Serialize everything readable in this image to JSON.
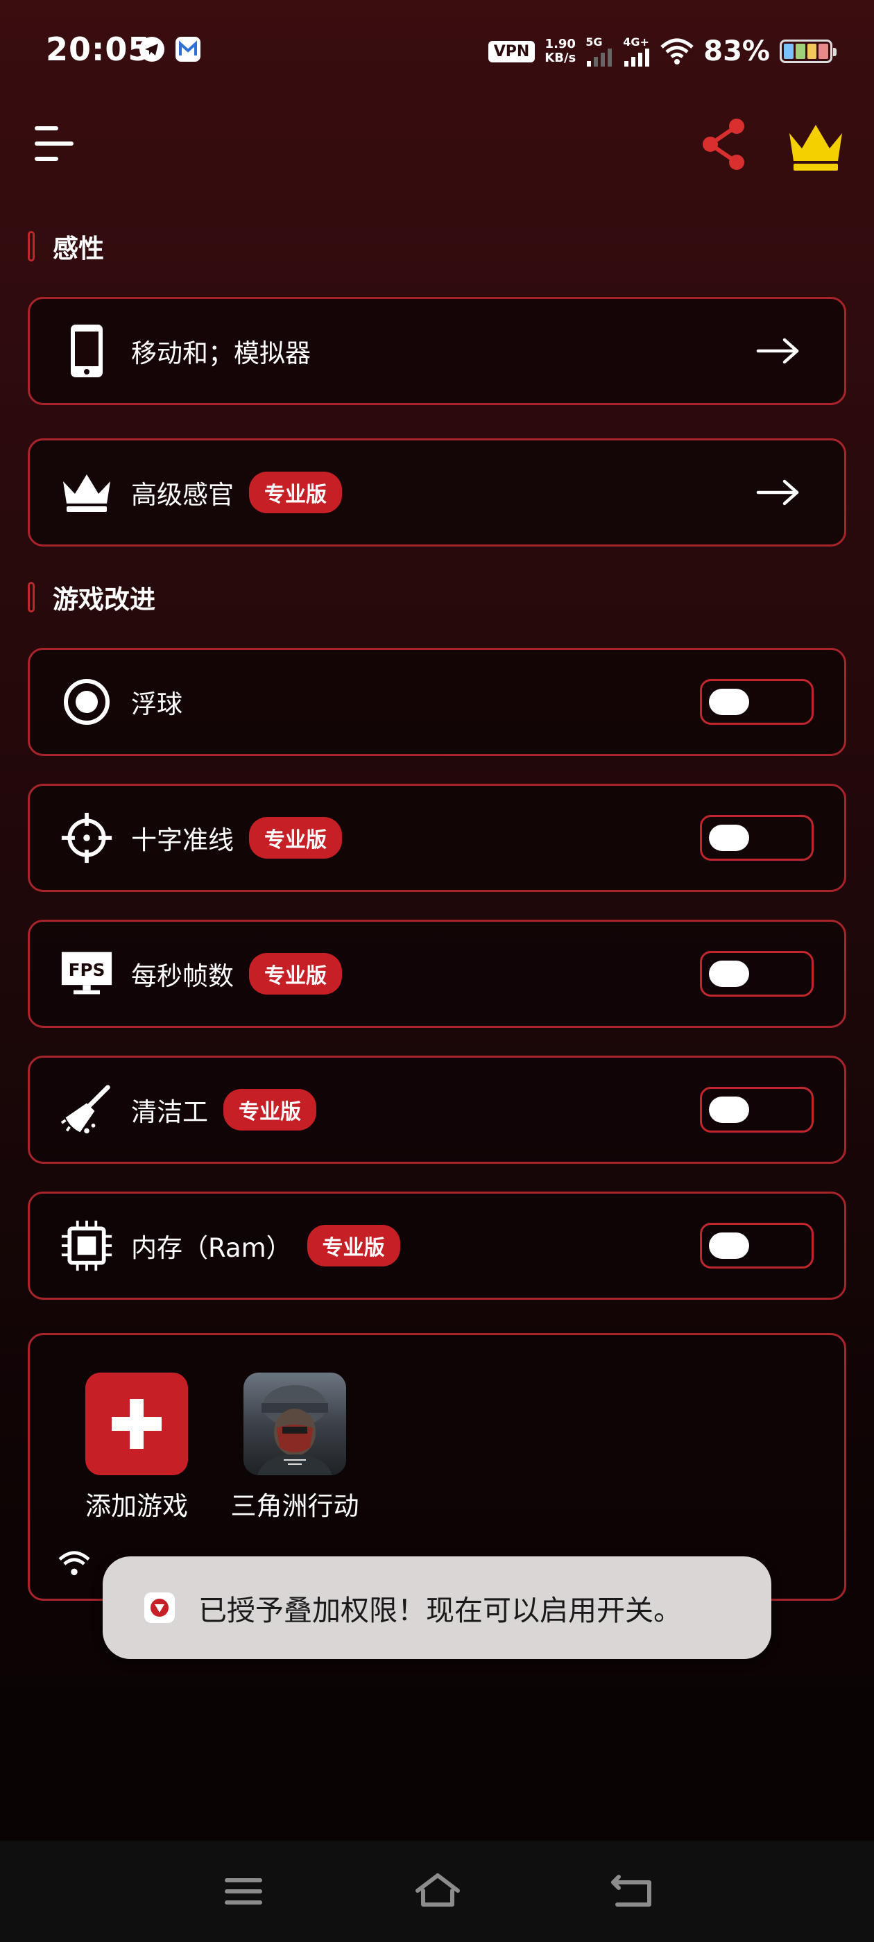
{
  "status_bar": {
    "time": "20:05",
    "vpn": "VPN",
    "speed_value": "1.90",
    "speed_unit": "KB/s",
    "net1": "5G",
    "net2": "4G+",
    "battery": "83%"
  },
  "sections": {
    "sensitivity": "感性",
    "game_improvement": "游戏改进"
  },
  "sensitivity_rows": [
    {
      "label": "移动和；模拟器",
      "icon": "phone-icon"
    },
    {
      "label": "高级感官",
      "icon": "crown-icon",
      "badge": "专业版"
    }
  ],
  "game_rows": [
    {
      "label": "浮球",
      "icon": "floating-ball-icon",
      "enabled": false
    },
    {
      "label": "十字准线",
      "icon": "crosshair-icon",
      "badge": "专业版",
      "enabled": false
    },
    {
      "label": "每秒帧数",
      "icon": "fps-monitor-icon",
      "badge": "专业版",
      "enabled": false
    },
    {
      "label": "清洁工",
      "icon": "broom-icon",
      "badge": "专业版",
      "enabled": false
    },
    {
      "label": "内存（Ram）",
      "icon": "ram-chip-icon",
      "badge": "专业版",
      "enabled": false
    }
  ],
  "games": [
    {
      "label": "添加游戏",
      "icon": "plus-icon"
    },
    {
      "label": "三角洲行动",
      "icon": "game-cover-soldier"
    }
  ],
  "toast": {
    "text": "已授予叠加权限！现在可以启用开关。"
  },
  "colors": {
    "accent": "#c61f26",
    "crown": "#f5d000",
    "share": "#d9302f",
    "toast_bg": "#d9d6d5"
  }
}
